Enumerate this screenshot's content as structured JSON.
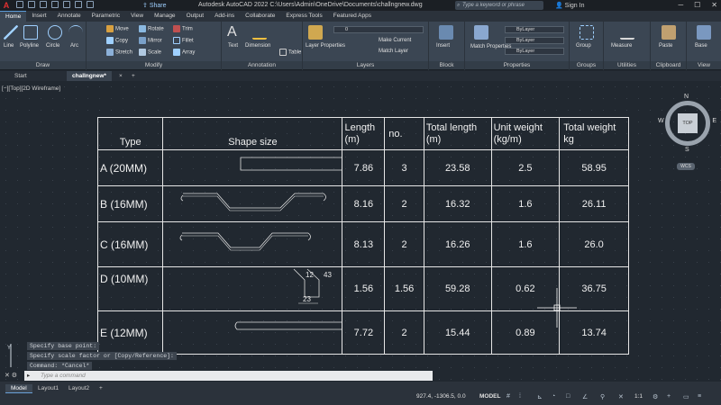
{
  "app": {
    "logo": "A",
    "share": "Share",
    "title": "Autodesk AutoCAD 2022    C:\\Users\\Admin\\OneDrive\\Documents\\challngnew.dwg",
    "search_placeholder": "Type a keyword or phrase",
    "signin": "Sign In"
  },
  "ribbon_tabs": [
    "Home",
    "Insert",
    "Annotate",
    "Parametric",
    "View",
    "Manage",
    "Output",
    "Add-ins",
    "Collaborate",
    "Express Tools",
    "Featured Apps"
  ],
  "ribbon": {
    "draw": {
      "title": "Draw",
      "line": "Line",
      "polyline": "Polyline",
      "circle": "Circle",
      "arc": "Arc"
    },
    "modify": {
      "title": "Modify",
      "move": "Move",
      "rotate": "Rotate",
      "trim": "Trim",
      "copy": "Copy",
      "mirror": "Mirror",
      "fillet": "Fillet",
      "stretch": "Stretch",
      "scale": "Scale",
      "array": "Array"
    },
    "annotation": {
      "title": "Annotation",
      "text": "Text",
      "dimension": "Dimension",
      "table": "Table"
    },
    "layers": {
      "title": "Layers",
      "layer_properties": "Layer Properties",
      "current_layer": "0",
      "make_current": "Make Current",
      "match_layer": "Match Layer"
    },
    "block": {
      "title": "Block",
      "insert": "Insert"
    },
    "properties": {
      "title": "Properties",
      "match": "Match Properties",
      "color": "ByLayer",
      "linetype": "ByLayer",
      "lineweight": "ByLayer"
    },
    "groups": {
      "title": "Groups",
      "group": "Group"
    },
    "utilities": {
      "title": "Utilities",
      "measure": "Measure"
    },
    "clipboard": {
      "title": "Clipboard",
      "paste": "Paste"
    },
    "view": {
      "title": "View",
      "base": "Base"
    }
  },
  "file_tabs": {
    "start": "Start",
    "current": "challngnew*"
  },
  "viewport_label": "[−][Top][2D Wireframe]",
  "viewcube": {
    "top": "TOP",
    "n": "N",
    "s": "S",
    "e": "E",
    "w": "W",
    "wcs": "WCS"
  },
  "table": {
    "headers": [
      "Type",
      "Shape size",
      "Length\n(m)",
      "no.",
      "Total length\n(m)",
      "Unit weight\n(kg/m)",
      "Total weight\nkg"
    ],
    "rows": [
      {
        "type": "A (20MM)",
        "length": "7.86",
        "no": "3",
        "total_length": "23.58",
        "unit_weight": "2.5",
        "total_weight": "58.95"
      },
      {
        "type": "B (16MM)",
        "length": "8.16",
        "no": "2",
        "total_length": "16.32",
        "unit_weight": "1.6",
        "total_weight": "26.11"
      },
      {
        "type": "C (16MM)",
        "length": "8.13",
        "no": "2",
        "total_length": "16.26",
        "unit_weight": "1.6",
        "total_weight": "26.0"
      },
      {
        "type": "D (10MM)",
        "length": "1.56",
        "no": "1.56",
        "total_length": "59.28",
        "unit_weight": "0.62",
        "total_weight": "36.75"
      },
      {
        "type": "E (12MM)",
        "length": "7.72",
        "no": "2",
        "total_length": "15.44",
        "unit_weight": "0.89",
        "total_weight": "13.74"
      }
    ],
    "shape_d_dims": {
      "a": "12",
      "b": "43",
      "c": "23"
    }
  },
  "command_history": [
    "Specify base point:",
    "Specify scale factor or [Copy/Reference]:",
    "Command: *Cancel*"
  ],
  "command_placeholder": "Type a command",
  "layout_tabs": [
    "Model",
    "Layout1",
    "Layout2"
  ],
  "status": {
    "coords": "927.4, -1306.5, 0.0",
    "model": "MODEL",
    "scale": "1:1"
  }
}
